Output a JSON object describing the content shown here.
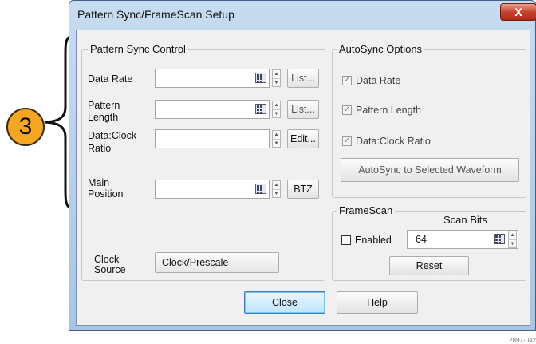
{
  "callout": {
    "number": "3"
  },
  "window": {
    "title": "Pattern Sync/FrameScan Setup",
    "close_glyph": "X"
  },
  "pattern_sync": {
    "legend": "Pattern Sync Control",
    "data_rate": {
      "label": "Data Rate",
      "value": "",
      "button": "List..."
    },
    "pattern_length": {
      "label_line1": "Pattern",
      "label_line2": "Length",
      "value": "",
      "button": "List..."
    },
    "data_clock_ratio": {
      "label_line1": "Data:Clock",
      "label_line2": "Ratio",
      "value": "",
      "button": "Edit..."
    },
    "main_position": {
      "label_line1": "Main",
      "label_line2": "Position",
      "value": "",
      "button": "BTZ"
    },
    "clock_source": {
      "label_line1": "Clock",
      "label_line2": "Source",
      "value": "Clock/Prescale"
    }
  },
  "autosync": {
    "legend": "AutoSync Options",
    "options": [
      {
        "label": "Data Rate",
        "checked": true,
        "enabled": false
      },
      {
        "label": "Pattern Length",
        "checked": true,
        "enabled": false
      },
      {
        "label": "Data:Clock Ratio",
        "checked": true,
        "enabled": false
      }
    ],
    "check_glyph": "✓",
    "button": "AutoSync to Selected Waveform"
  },
  "framescan": {
    "legend": "FrameScan",
    "scan_bits_label": "Scan Bits",
    "enabled_label": "Enabled",
    "enabled_checked": false,
    "scan_bits_value": "64",
    "reset_button": "Reset"
  },
  "footer": {
    "close_button": "Close",
    "help_button": "Help"
  },
  "figure_id": "2897-042",
  "icons": [
    "calculator-icon",
    "spin-up-icon",
    "spin-down-icon",
    "close-icon",
    "checkbox-icon"
  ],
  "colors": {
    "callout": "#f5a623",
    "title_bar": "#b9d1ea",
    "close_button": "#c4432f"
  }
}
